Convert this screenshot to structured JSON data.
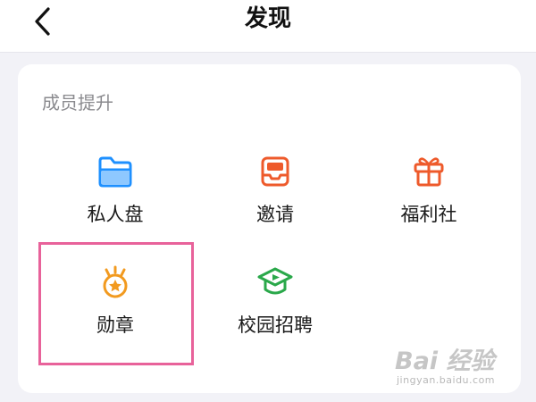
{
  "header": {
    "title": "发现",
    "back_icon": "chevron-left-icon"
  },
  "section": {
    "title": "成员提升",
    "items": [
      {
        "label": "私人盘",
        "icon": "folder-icon",
        "color": "#1e90ff"
      },
      {
        "label": "邀请",
        "icon": "invite-box-icon",
        "color": "#ee5a2b"
      },
      {
        "label": "福利社",
        "icon": "gift-icon",
        "color": "#ee5a2b"
      },
      {
        "label": "勋章",
        "icon": "medal-icon",
        "color": "#f29a1f"
      },
      {
        "label": "校园招聘",
        "icon": "graduation-cap-icon",
        "color": "#2aa84a"
      }
    ]
  },
  "watermark": {
    "brand": "Bai 经验",
    "url": "jingyan.baidu.com"
  }
}
